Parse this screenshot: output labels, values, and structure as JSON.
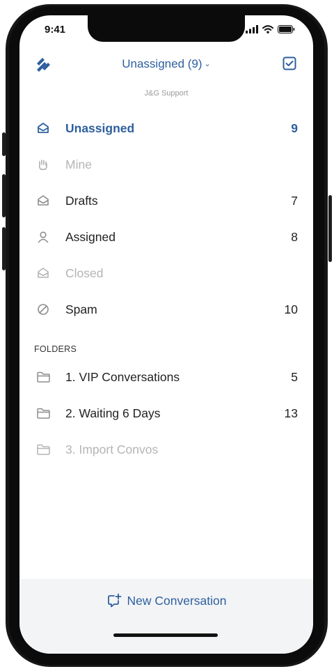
{
  "status_bar": {
    "time": "9:41"
  },
  "nav": {
    "title": "Unassigned (9)",
    "chevron": "⌄"
  },
  "org": {
    "name": "J&G Support"
  },
  "mailboxes": [
    {
      "label": "Unassigned",
      "count": "9",
      "icon": "inbox-icon",
      "state": "selected"
    },
    {
      "label": "Mine",
      "count": "",
      "icon": "hand-icon",
      "state": "disabled"
    },
    {
      "label": "Drafts",
      "count": "7",
      "icon": "inbox-icon",
      "state": "normal"
    },
    {
      "label": "Assigned",
      "count": "8",
      "icon": "person-icon",
      "state": "normal"
    },
    {
      "label": "Closed",
      "count": "",
      "icon": "inbox-icon",
      "state": "disabled"
    },
    {
      "label": "Spam",
      "count": "10",
      "icon": "no-entry-icon",
      "state": "normal"
    }
  ],
  "folders": {
    "header": "FOLDERS",
    "items": [
      {
        "label": "1. VIP Conversations",
        "count": "5",
        "icon": "folder-icon",
        "state": "normal"
      },
      {
        "label": "2. Waiting 6 Days",
        "count": "13",
        "icon": "folder-icon",
        "state": "normal"
      },
      {
        "label": "3. Import Convos",
        "count": "",
        "icon": "folder-icon",
        "state": "disabled"
      }
    ]
  },
  "bottom": {
    "new_conversation_label": "New Conversation"
  },
  "colors": {
    "accent": "#2e5f9e",
    "text": "#222222",
    "muted": "#b4b4b4",
    "bottom_bg": "#f3f4f6"
  }
}
